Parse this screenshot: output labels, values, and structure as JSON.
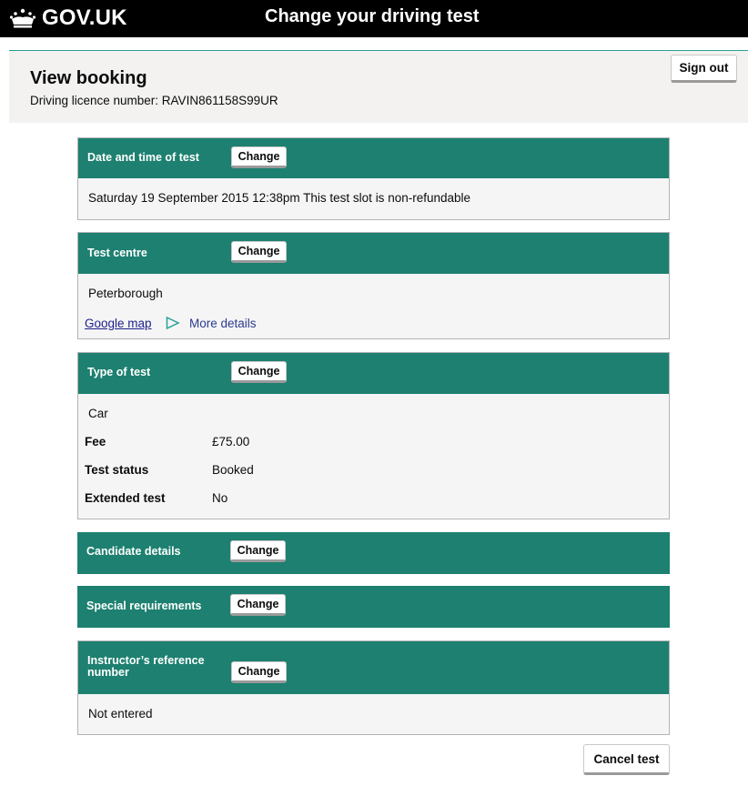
{
  "header": {
    "logo_text": "GOV.UK",
    "service_name": "Change your driving test",
    "crown_icon": "crown-icon"
  },
  "subheader": {
    "title": "View booking",
    "licence_label": "Driving licence number: RAVIN861158S99UR",
    "sign_out_label": "Sign out"
  },
  "sections": {
    "date_time": {
      "label": "Date and time of test",
      "change_label": "Change",
      "value": "Saturday 19 September 2015 12:38pm This test slot is non-refundable"
    },
    "test_centre": {
      "label": "Test centre",
      "change_label": "Change",
      "value": "Peterborough",
      "map_link": "Google map",
      "more_details": "More details",
      "more_details_icon": "play-triangle-icon"
    },
    "type_of_test": {
      "label": "Type of test",
      "change_label": "Change",
      "value": "Car",
      "rows": [
        {
          "key": "Fee",
          "value": "£75.00"
        },
        {
          "key": "Test status",
          "value": "Booked"
        },
        {
          "key": "Extended test",
          "value": "No"
        }
      ]
    },
    "candidate": {
      "label": "Candidate details",
      "change_label": "Change"
    },
    "special": {
      "label": "Special requirements",
      "change_label": "Change"
    },
    "instructor": {
      "label_line1": "Instructor’s reference",
      "label_line2": "number",
      "change_label": "Change",
      "value": "Not entered"
    }
  },
  "footer": {
    "cancel_label": "Cancel test"
  },
  "colors": {
    "header_bg": "#000000",
    "panel_head": "#1d8070",
    "accent_rule": "#28a197",
    "subheader_bg": "#f3f2f1"
  }
}
